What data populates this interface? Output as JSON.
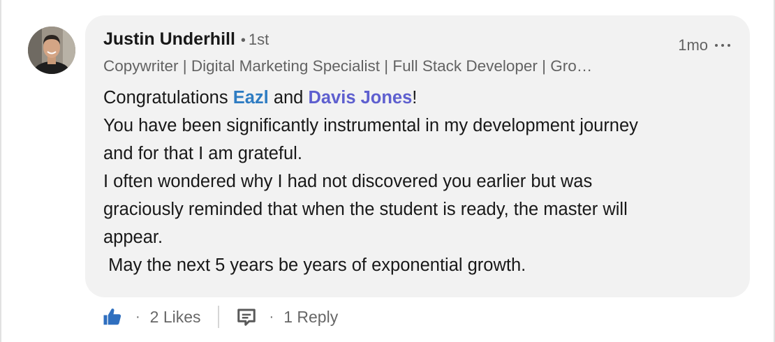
{
  "comment": {
    "author_name": "Justin Underhill",
    "connection_degree": "1st",
    "headline": "Copywriter | Digital Marketing Specialist | Full Stack Developer | Gro…",
    "timestamp": "1mo",
    "body": {
      "line1_prefix": "Congratulations ",
      "mention1": "Eazl",
      "line1_middle": " and ",
      "mention2": "Davis Jones",
      "line1_suffix": "!",
      "line2": "You have been significantly instrumental in my development journey",
      "line3": "and for that I am grateful.",
      "line4": "I often wondered why I had not discovered you earlier but was",
      "line5": "graciously reminded that when the student is ready, the master will",
      "line6": "appear.",
      "line7": " May the next 5 years be years of exponential growth."
    }
  },
  "actions": {
    "like_icon": "thumbs-up-icon",
    "likes_label": "2 Likes",
    "reply_icon": "comment-icon",
    "replies_label": "1 Reply",
    "separator": "·"
  },
  "colors": {
    "bubble_bg": "#f2f2f2",
    "mention_company": "#2e7cc2",
    "mention_person": "#5e5fcf",
    "like_blue": "#2f6fbf"
  }
}
